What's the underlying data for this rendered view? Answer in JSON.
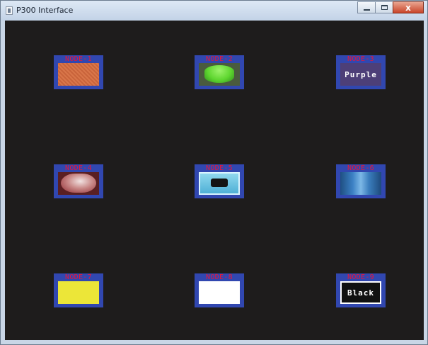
{
  "window": {
    "title": "P300 Interface",
    "close_glyph": "x",
    "icon": "app-window-icon"
  },
  "colors": {
    "background": "#1e1c1c",
    "tile_frame": "#3147b0",
    "label": "#e8163a"
  },
  "nodes": [
    {
      "label": "NODE-1",
      "content": "orange-textured-fabric",
      "text": ""
    },
    {
      "label": "NODE-2",
      "content": "green-bowl",
      "text": ""
    },
    {
      "label": "NODE-3",
      "content": "purple-color-swatch",
      "text": "Purple"
    },
    {
      "label": "NODE-4",
      "content": "red-white-cushion",
      "text": ""
    },
    {
      "label": "NODE-5",
      "content": "light-blue-object",
      "text": ""
    },
    {
      "label": "NODE-6",
      "content": "blue-bottle",
      "text": ""
    },
    {
      "label": "NODE-7",
      "content": "yellow-color-swatch",
      "text": ""
    },
    {
      "label": "NODE-8",
      "content": "white-color-swatch",
      "text": ""
    },
    {
      "label": "NODE-9",
      "content": "black-color-swatch",
      "text": "Black"
    }
  ]
}
